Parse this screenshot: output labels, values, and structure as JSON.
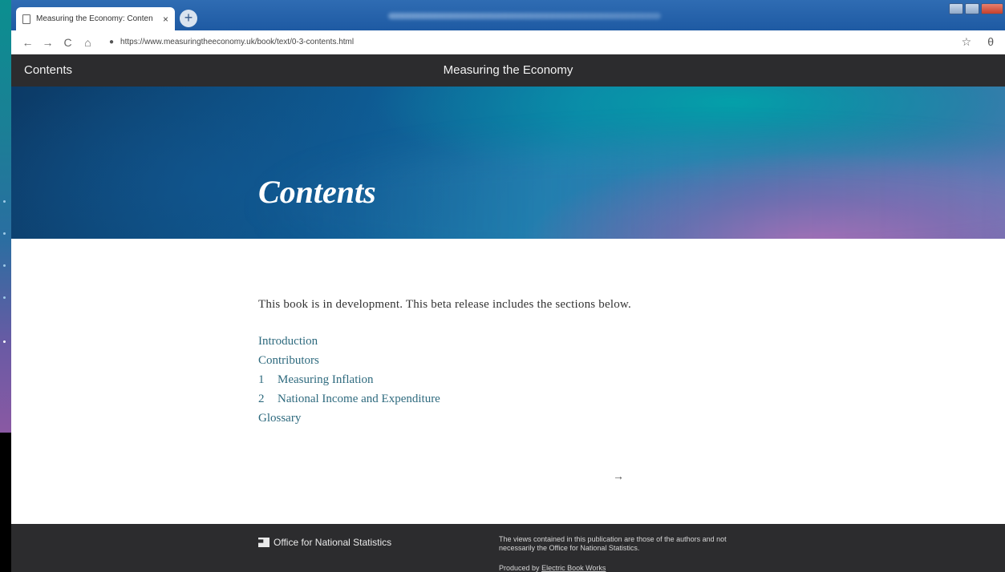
{
  "browser": {
    "tab_title": "Measuring the Economy: Conten",
    "tab_close": "×",
    "new_tab": "+",
    "url": "https://www.measuringtheeconomy.uk/book/text/0-3-contents.html",
    "nav": {
      "back": "←",
      "forward": "→",
      "reload": "C",
      "home": "⌂"
    },
    "star_icon": "☆",
    "account_icon": "θ"
  },
  "site_header": {
    "contents_link": "Contents",
    "site_title": "Measuring the Economy"
  },
  "hero": {
    "title": "Contents"
  },
  "main": {
    "intro": "This book is in development. This beta release includes the sections below.",
    "toc": [
      {
        "number": "",
        "label": "Introduction"
      },
      {
        "number": "",
        "label": "Contributors"
      },
      {
        "number": "1",
        "label": "Measuring Inflation"
      },
      {
        "number": "2",
        "label": "National Income and Expenditure"
      },
      {
        "number": "",
        "label": "Glossary"
      }
    ],
    "next_arrow": "→"
  },
  "footer": {
    "logo_text": "Office for National Statistics",
    "note": "The views contained in this publication are those of the authors and not necessarily the Office for National Statistics.",
    "credit_prefix": "Produced by",
    "credit_link": "Electric Book Works"
  }
}
